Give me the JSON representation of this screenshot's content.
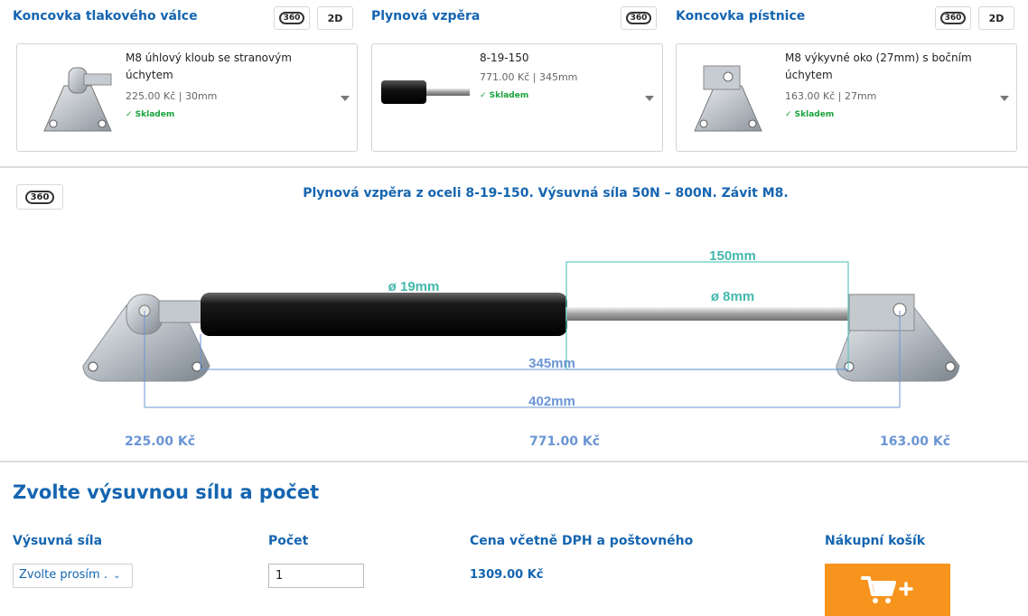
{
  "columns": [
    {
      "title": "Koncovka tlakového válce",
      "btn360": "360",
      "btn2d": "2D",
      "card": {
        "name_line1": "M8 úhlový kloub se stranovým",
        "name_line2": "úchytem",
        "meta": "225.00 Kč | 30mm",
        "stock": "✓ Skladem"
      }
    },
    {
      "title": "Plynová vzpěra",
      "btn360": "360",
      "card": {
        "name_line1": "8-19-150",
        "meta": "771.00 Kč | 345mm",
        "stock": "✓ Skladem"
      }
    },
    {
      "title": "Koncovka pístnice",
      "btn360": "360",
      "btn2d": "2D",
      "card": {
        "name_line1": "M8 výkyvné oko (27mm) s bočním",
        "name_line2": "úchytem",
        "meta": "163.00 Kč | 27mm",
        "stock": "✓ Skladem"
      }
    }
  ],
  "viewer": {
    "btn360": "360",
    "title": "Plynová vzpěra z oceli 8-19-150. Výsuvná síla 50N – 800N. Závit M8.",
    "dims": {
      "stroke": "150mm",
      "body_dia": "ø 19mm",
      "rod_dia": "ø 8mm",
      "length": "345mm",
      "total": "402mm"
    },
    "prices": [
      "225.00 Kč",
      "771.00 Kč",
      "163.00 Kč"
    ]
  },
  "order": {
    "heading": "Zvolte výsuvnou sílu a počet",
    "force_label": "Výsuvná síla",
    "force_value": "Zvolte prosím .",
    "qty_label": "Počet",
    "qty_value": "1",
    "price_label": "Cena včetně DPH a poštovného",
    "price_value": "1309.00 Kč",
    "cart_label": "Nákupní košík"
  },
  "colors": {
    "accent": "#1565b0",
    "stock": "#1aa23c",
    "cart": "#f7941d",
    "dim_line": "#6b95d5",
    "stroke_box": "#5ec8c0"
  }
}
